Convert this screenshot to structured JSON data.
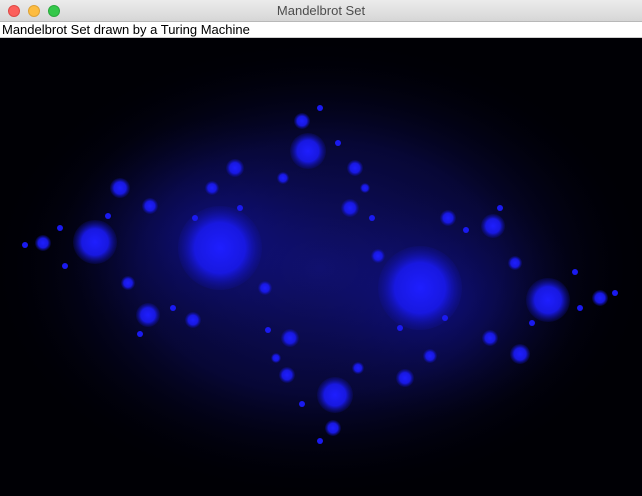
{
  "window": {
    "title": "Mandelbrot Set"
  },
  "label": {
    "text": "Mandelbrot Set drawn by a Turing Machine"
  },
  "canvas": {
    "content": "fractal-image",
    "colors": {
      "background": "#000005",
      "glow": "#0a0a60",
      "mid": "#1a1ad0",
      "bright": "#1e1eff"
    }
  },
  "icons": {
    "close": "close-button-icon",
    "minimize": "minimize-button-icon",
    "zoom": "zoom-button-icon"
  }
}
